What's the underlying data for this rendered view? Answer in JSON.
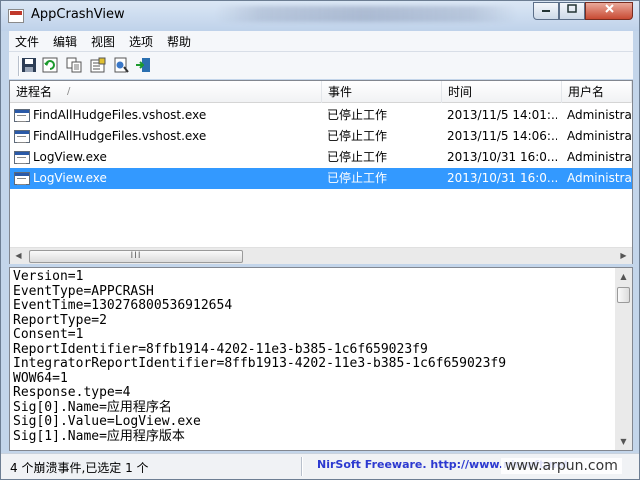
{
  "window": {
    "title": "AppCrashView"
  },
  "menu": [
    "文件",
    "编辑",
    "视图",
    "选项",
    "帮助"
  ],
  "toolbar": {
    "icons": [
      "save-icon",
      "refresh-icon",
      "copy-icon",
      "properties-icon",
      "html-report-icon",
      "exit-icon"
    ]
  },
  "list": {
    "columns": [
      "进程名",
      "事件",
      "时间",
      "用户名"
    ],
    "sort_indicator": "/",
    "rows": [
      {
        "name": "FindAllHudgeFiles.vshost.exe",
        "event": "已停止工作",
        "time": "2013/11/5 14:01:...",
        "user": "Administrat"
      },
      {
        "name": "FindAllHudgeFiles.vshost.exe",
        "event": "已停止工作",
        "time": "2013/11/5 14:06:...",
        "user": "Administrat"
      },
      {
        "name": "LogView.exe",
        "event": "已停止工作",
        "time": "2013/10/31 16:0...",
        "user": "Administrat"
      },
      {
        "name": "LogView.exe",
        "event": "已停止工作",
        "time": "2013/10/31 16:0...",
        "user": "Administrat"
      }
    ],
    "selected_row": 3,
    "hscroll_thumb_grip": "III"
  },
  "detail": {
    "lines": [
      "Version=1",
      "EventType=APPCRASH",
      "EventTime=130276800536912654",
      "ReportType=2",
      "Consent=1",
      "ReportIdentifier=8ffb1914-4202-11e3-b385-1c6f659023f9",
      "IntegratorReportIdentifier=8ffb1913-4202-11e3-b385-1c6f659023f9",
      "WOW64=1",
      "Response.type=4",
      "Sig[0].Name=应用程序名",
      "Sig[0].Value=LogView.exe",
      "Sig[1].Name=应用程序版本"
    ]
  },
  "status": {
    "left": "4 个崩溃事件,已选定 1 个",
    "link": "NirSoft Freeware.  http://www.nirsoft.net"
  },
  "watermark": "www.arpun.com",
  "colors": {
    "selection": "#3399ff",
    "link": "#2c39d0",
    "close_button": "#c84a33"
  }
}
